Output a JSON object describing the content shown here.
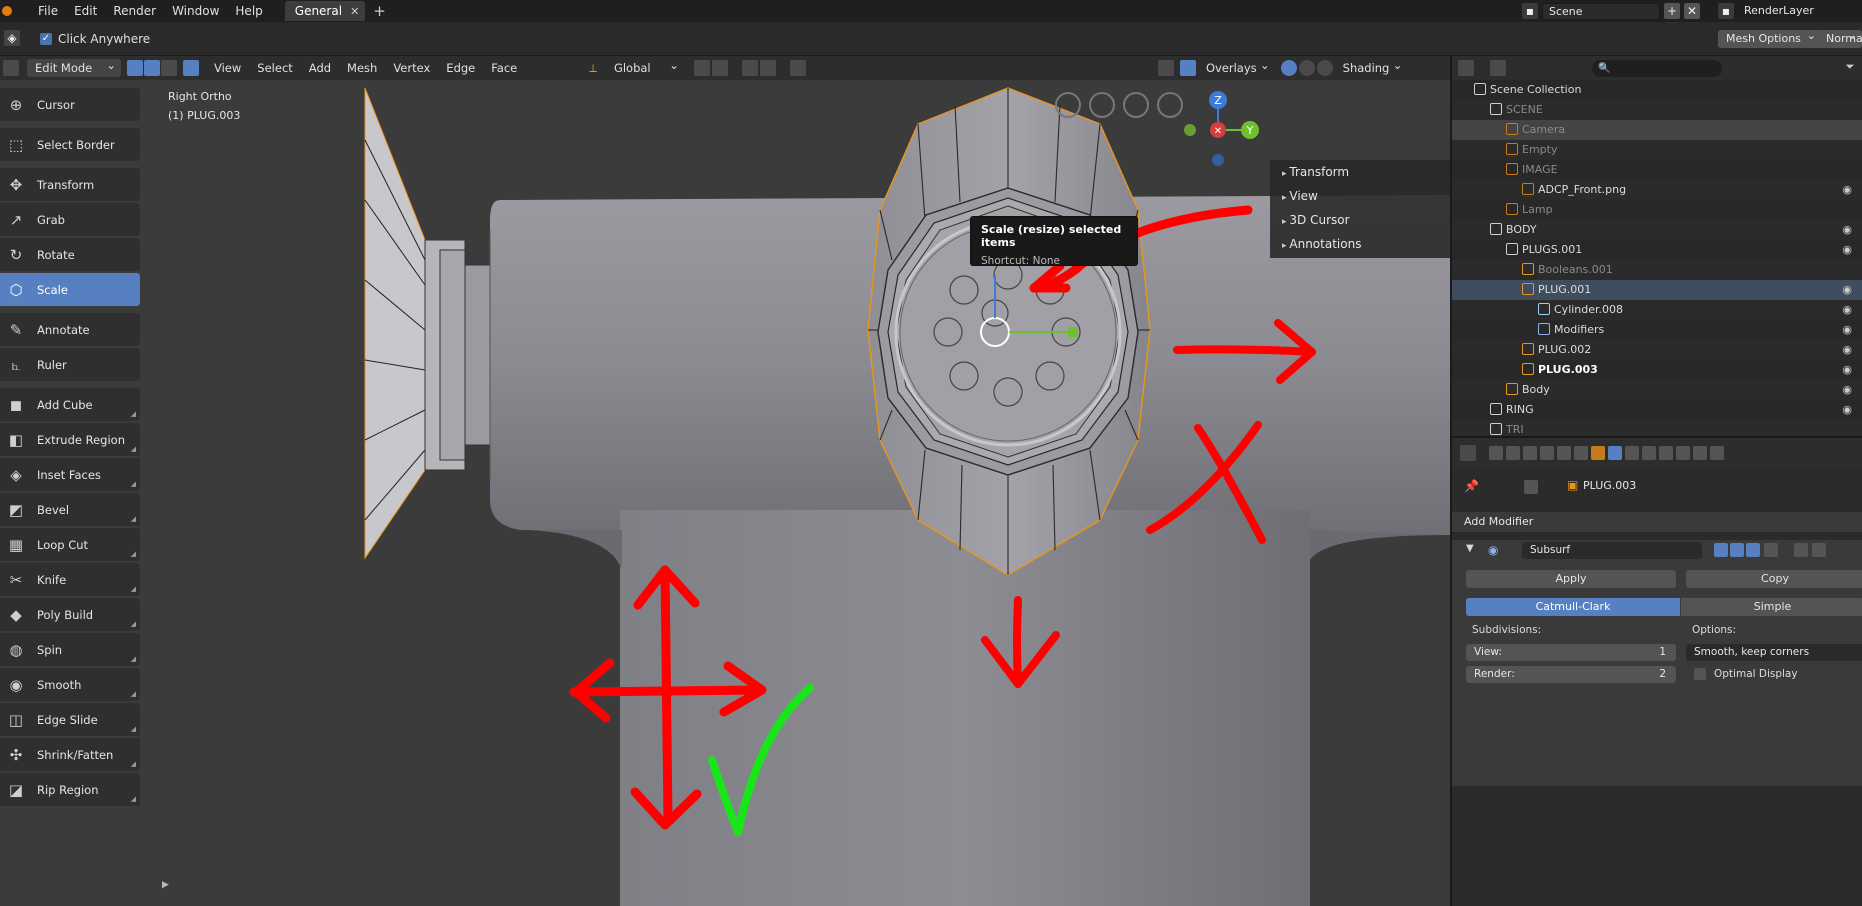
{
  "topbar": {
    "menus": [
      "File",
      "Edit",
      "Render",
      "Window",
      "Help"
    ],
    "workspace_tab": "General",
    "scene": "Scene",
    "render_layer": "RenderLayer"
  },
  "toolsettings": {
    "click_anywhere_label": "Click Anywhere",
    "mesh_options": "Mesh Options",
    "normal": "Normal"
  },
  "viewport_header": {
    "mode": "Edit Mode",
    "menus": [
      "View",
      "Select",
      "Add",
      "Mesh",
      "Vertex",
      "Edge",
      "Face"
    ],
    "orientation": "Global",
    "overlays": "Overlays",
    "shading": "Shading"
  },
  "viewport": {
    "view_name": "Right Ortho",
    "object_name": "(1) PLUG.003",
    "gizmo_axes": [
      "Z",
      "Y"
    ]
  },
  "tools": [
    {
      "label": "Cursor",
      "icon": "cursor-icon",
      "glyph": "⊕"
    },
    {
      "label": "Select Border",
      "icon": "select-border-icon",
      "glyph": "⬚"
    },
    {
      "label": "Transform",
      "icon": "transform-icon",
      "glyph": "✥"
    },
    {
      "label": "Grab",
      "icon": "grab-icon",
      "glyph": "↗"
    },
    {
      "label": "Rotate",
      "icon": "rotate-icon",
      "glyph": "↻"
    },
    {
      "label": "Scale",
      "icon": "scale-icon",
      "glyph": "⬡"
    },
    {
      "label": "Annotate",
      "icon": "annotate-icon",
      "glyph": "✎"
    },
    {
      "label": "Ruler",
      "icon": "ruler-icon",
      "glyph": "⦜"
    },
    {
      "label": "Add Cube",
      "icon": "add-cube-icon",
      "glyph": "◼"
    },
    {
      "label": "Extrude Region",
      "icon": "extrude-region-icon",
      "glyph": "◧"
    },
    {
      "label": "Inset Faces",
      "icon": "inset-faces-icon",
      "glyph": "◈"
    },
    {
      "label": "Bevel",
      "icon": "bevel-icon",
      "glyph": "◩"
    },
    {
      "label": "Loop Cut",
      "icon": "loop-cut-icon",
      "glyph": "▦"
    },
    {
      "label": "Knife",
      "icon": "knife-icon",
      "glyph": "✂"
    },
    {
      "label": "Poly Build",
      "icon": "poly-build-icon",
      "glyph": "◆"
    },
    {
      "label": "Spin",
      "icon": "spin-icon",
      "glyph": "◍"
    },
    {
      "label": "Smooth",
      "icon": "smooth-icon",
      "glyph": "◉"
    },
    {
      "label": "Edge Slide",
      "icon": "edge-slide-icon",
      "glyph": "◫"
    },
    {
      "label": "Shrink/Fatten",
      "icon": "shrink-fatten-icon",
      "glyph": "✣"
    },
    {
      "label": "Rip Region",
      "icon": "rip-region-icon",
      "glyph": "◪"
    }
  ],
  "active_tool": "Scale",
  "npanel": [
    "Transform",
    "View",
    "3D Cursor",
    "Annotations"
  ],
  "tooltip": {
    "title": "Scale (resize) selected items",
    "shortcut": "Shortcut: None"
  },
  "outliner": {
    "rows": [
      {
        "label": "Scene Collection",
        "indent": 0,
        "icon": "collection-icon",
        "style": ""
      },
      {
        "label": "SCENE",
        "indent": 1,
        "icon": "collection-icon",
        "style": "dim"
      },
      {
        "label": "Camera",
        "indent": 2,
        "icon": "camera-icon",
        "style": "dim"
      },
      {
        "label": "Empty",
        "indent": 2,
        "icon": "empty-icon",
        "style": "dim"
      },
      {
        "label": "IMAGE",
        "indent": 2,
        "icon": "empty-icon",
        "style": "dim"
      },
      {
        "label": "ADCP_Front.png",
        "indent": 3,
        "icon": "image-icon",
        "style": ""
      },
      {
        "label": "Lamp",
        "indent": 2,
        "icon": "lamp-icon",
        "style": "dim"
      },
      {
        "label": "BODY",
        "indent": 1,
        "icon": "collection-icon",
        "style": ""
      },
      {
        "label": "PLUGS.001",
        "indent": 2,
        "icon": "collection-icon",
        "style": ""
      },
      {
        "label": "Booleans.001",
        "indent": 3,
        "icon": "mesh-icon",
        "style": "dim"
      },
      {
        "label": "PLUG.001",
        "indent": 3,
        "icon": "mesh-icon",
        "style": "sel"
      },
      {
        "label": "Cylinder.008",
        "indent": 4,
        "icon": "mesh-data-icon",
        "style": ""
      },
      {
        "label": "Modifiers",
        "indent": 4,
        "icon": "wrench-icon",
        "style": ""
      },
      {
        "label": "PLUG.002",
        "indent": 3,
        "icon": "mesh-icon",
        "style": ""
      },
      {
        "label": "PLUG.003",
        "indent": 3,
        "icon": "mesh-icon",
        "style": "bold"
      },
      {
        "label": "Body",
        "indent": 2,
        "icon": "mesh-icon",
        "style": ""
      },
      {
        "label": "RING",
        "indent": 1,
        "icon": "collection-icon",
        "style": ""
      },
      {
        "label": "TRI",
        "indent": 1,
        "icon": "collection-icon",
        "style": "dim"
      }
    ]
  },
  "properties": {
    "object": "PLUG.003",
    "add_modifier": "Add Modifier",
    "modifier_name": "Subsurf",
    "apply": "Apply",
    "copy": "Copy",
    "catmull_clark": "Catmull-Clark",
    "simple": "Simple",
    "subdivisions_label": "Subdivisions:",
    "view_label": "View:",
    "view_value": "1",
    "render_label": "Render:",
    "render_value": "2",
    "options_label": "Options:",
    "smooth_option": "Smooth, keep corners",
    "optimal_display": "Optimal Display"
  },
  "colors": {
    "accent": "#5680c2",
    "annotation_red": "#ff0000",
    "annotation_green": "#19e619",
    "selection_orange": "#e8961e"
  }
}
